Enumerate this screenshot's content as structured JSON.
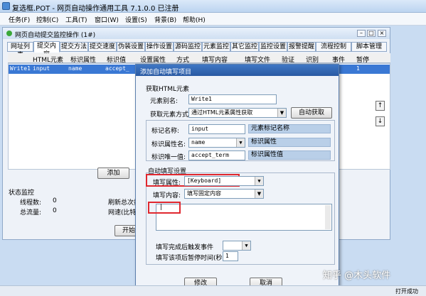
{
  "app": {
    "title": "复选框.POT - 网页自动操作通用工具 7.1.0.0 已注册"
  },
  "menu": [
    "任务(F)",
    "控制(C)",
    "工具(T)",
    "窗口(W)",
    "设置(S)",
    "背景(B)",
    "帮助(H)"
  ],
  "child": {
    "title": "网页自动提交监控操作 (1#)",
    "tabs": [
      "网址列表",
      "提交内容",
      "提交方法",
      "提交速度",
      "伪装设置",
      "操作设置",
      "源码监控",
      "元素监控",
      "其它监控",
      "监控设置",
      "报警提醒",
      "流程控制",
      "脚本管理"
    ],
    "grid_headers": [
      "HTML元素",
      "标识属性",
      "标识值",
      "设置属性",
      "方式",
      "填写内容",
      "填写文件",
      "验证",
      "识别",
      "事件",
      "暂停"
    ],
    "row": {
      "id": "Write1",
      "element": "input",
      "attr": "name",
      "value": "accept_",
      "pause": "1"
    },
    "add_label": "添加",
    "status_title": "状态监控",
    "status": {
      "threads_label": "线程数:",
      "threads": "0",
      "traffic_label": "总流量:",
      "traffic": "0",
      "refresh": "刷新总次数",
      "speed": "网速(比特/"
    },
    "start_label": "开始",
    "up_arrow": "↑",
    "down_arrow": "↓"
  },
  "dialog": {
    "title": "添加自动填写项目",
    "get_element": "获取HTML元素",
    "alias_label": "元素别名:",
    "alias_value": "Write1",
    "method_label": "获取元素方式:",
    "method_value": "通过HTML元素属性获取",
    "auto_get": "自动获取",
    "tag_label": "标记名称:",
    "tag_value": "input",
    "tag_hint": "元素标记名称",
    "attr_label": "标识属性名:",
    "attr_value": "name",
    "attr_hint": "标识属性",
    "unique_label": "标识唯一值:",
    "unique_value": "accept_term",
    "unique_hint": "标识属性值",
    "autofill_group": "自动填写设置",
    "fill_attr_label": "填写属性:",
    "fill_attr_value": "[Keyboard]",
    "fill_content_label": "填写内容:",
    "fill_content_value": "填写固定内容",
    "textarea_value": "|",
    "after_event_label": "填写完成后触发事件",
    "pause_label": "填写该项后暂停时间(秒)",
    "pause_value": "1",
    "ok": "修改",
    "cancel": "取消"
  },
  "watermark": "知乎 @木头软件",
  "statusbar": "打开成功"
}
